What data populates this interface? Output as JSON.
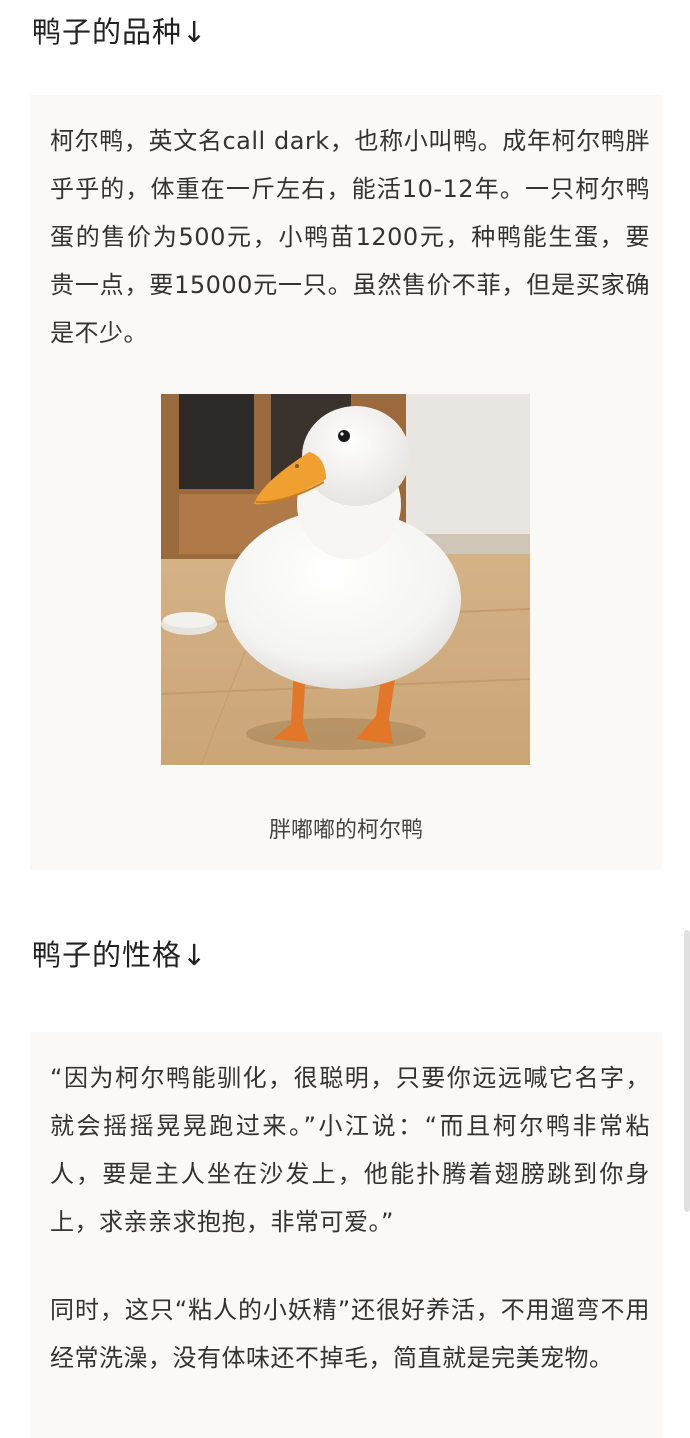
{
  "sections": [
    {
      "heading": "鸭子的品种↓",
      "paragraphs": [
        "柯尔鸭，英文名call dark，也称小叫鸭。成年柯尔鸭胖乎乎的，体重在一斤左右，能活10-12年。一只柯尔鸭蛋的售价为500元，小鸭苗1200元，种鸭能生蛋，要贵一点，要15000元一只。虽然售价不菲，但是买家确是不少。"
      ],
      "image": {
        "subject": "white call duck photo",
        "caption": "胖嘟嘟的柯尔鸭"
      }
    },
    {
      "heading": "鸭子的性格↓",
      "paragraphs": [
        "“因为柯尔鸭能驯化，很聪明，只要你远远喊它名字，就会摇摇晃晃跑过来。”小江说：“而且柯尔鸭非常粘人，要是主人坐在沙发上，他能扑腾着翅膀跳到你身上，求亲亲求抱抱，非常可爱。”",
        "同时，这只“粘人的小妖精”还很好养活，不用遛弯不用经常洗澡，没有体味还不掉毛，简直就是完美宠物。"
      ]
    }
  ],
  "colors": {
    "background": "#ffffff",
    "panel": "#faf9f8",
    "text": "#333333",
    "duck_beak": "#f0a030",
    "duck_feet": "#e2772a"
  }
}
